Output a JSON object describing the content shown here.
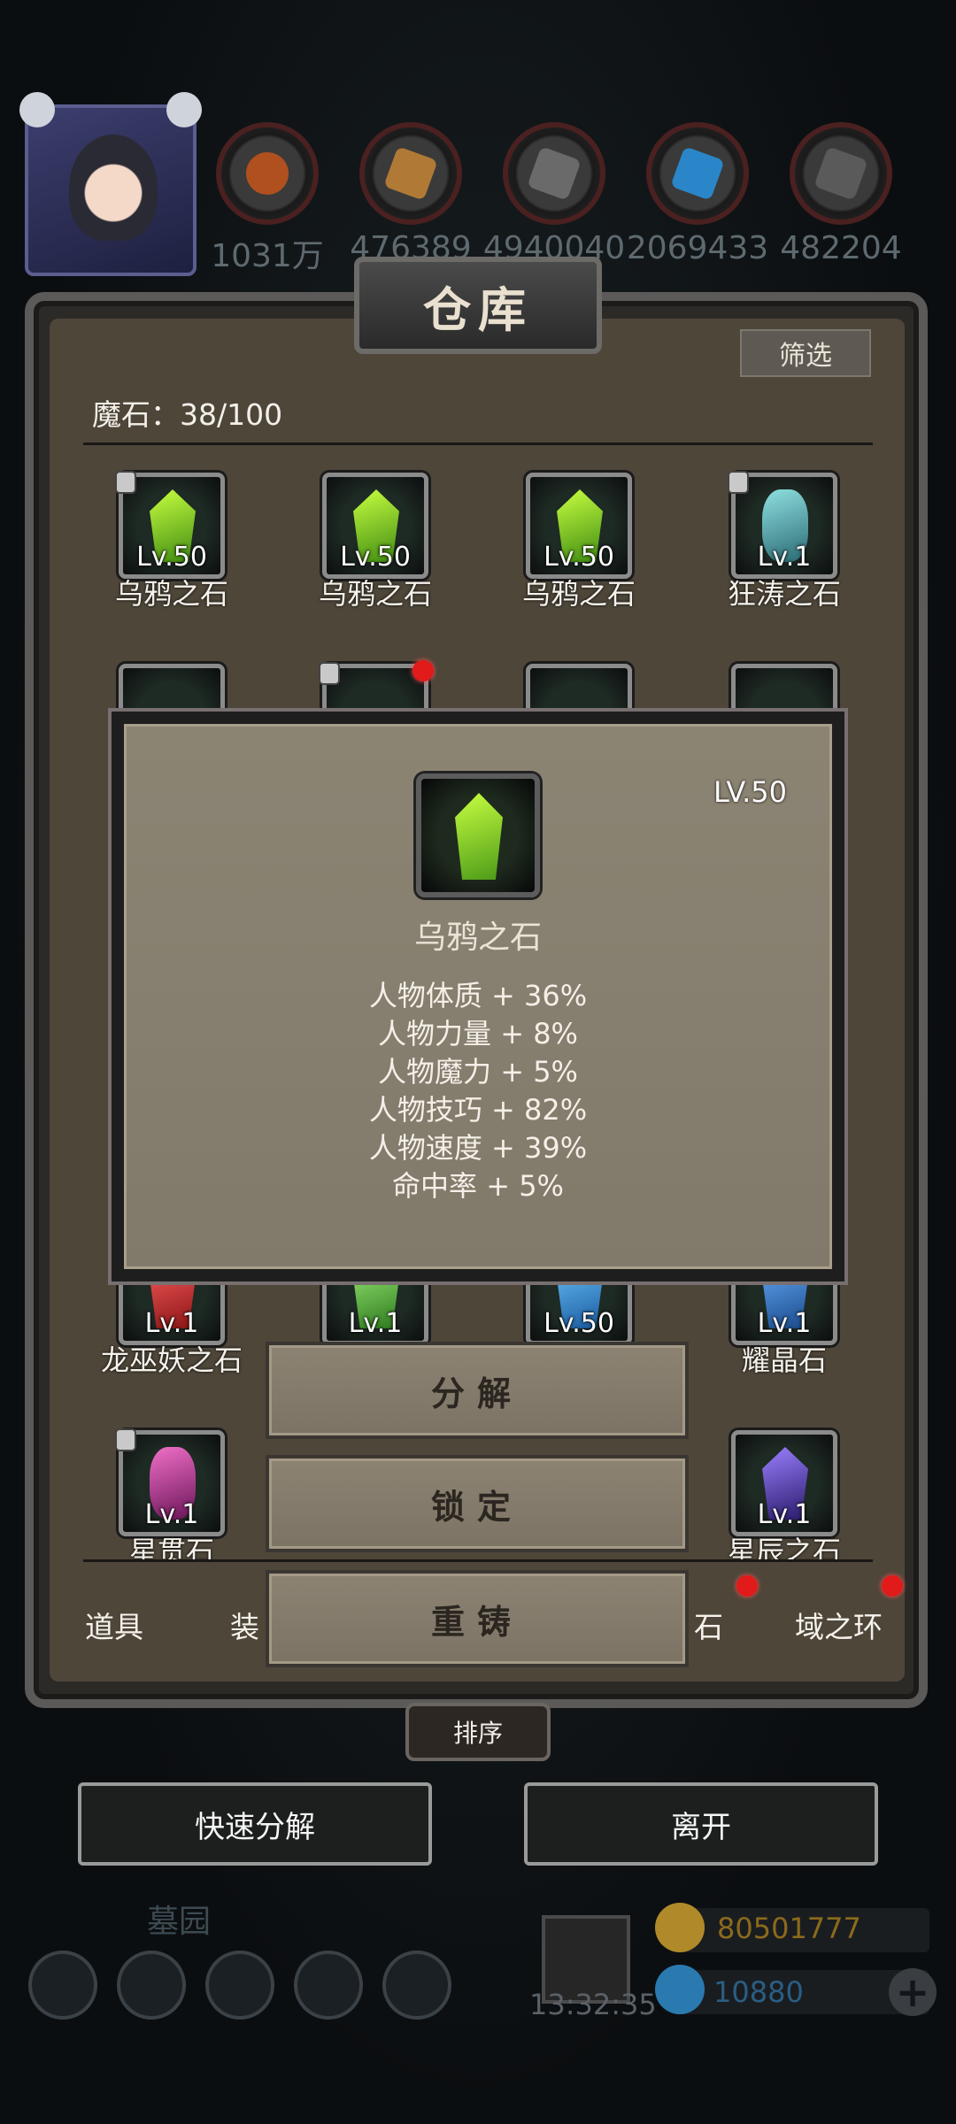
{
  "resources": [
    {
      "icon": "meat-icon",
      "value": "1031万"
    },
    {
      "icon": "wood-icon",
      "value": "476389"
    },
    {
      "icon": "iron-icon",
      "value": "4940040"
    },
    {
      "icon": "crystal-icon",
      "value": "2069433"
    },
    {
      "icon": "stone-icon",
      "value": "482204"
    }
  ],
  "warehouse": {
    "title": "仓库",
    "filter_label": "筛选",
    "count_label": "魔石：38/100"
  },
  "items_row1": [
    {
      "level": "Lv.50",
      "name": "乌鸦之石",
      "color": "#8ee02a",
      "locked": true
    },
    {
      "level": "Lv.50",
      "name": "乌鸦之石",
      "color": "#8ee02a",
      "locked": false
    },
    {
      "level": "Lv.50",
      "name": "乌鸦之石",
      "color": "#8ee02a",
      "locked": false
    },
    {
      "level": "Lv.1",
      "name": "狂涛之石",
      "color": "#4aa0a8",
      "locked": true
    }
  ],
  "items_row3": [
    {
      "level": "Lv.1",
      "name": "龙巫妖之石",
      "color": "#d02a2a"
    },
    {
      "level": "Lv.1",
      "name": "",
      "color": "#56b83a"
    },
    {
      "level": "Lv.50",
      "name": "",
      "color": "#2a8ad8"
    },
    {
      "level": "Lv.1",
      "name": "耀晶石",
      "color": "#2a74c8"
    }
  ],
  "items_row4": [
    {
      "level": "Lv.1",
      "name": "星贯石",
      "color": "#c0309a"
    },
    {
      "level": "Lv.1",
      "name": "星辰之石",
      "color": "#5c3cc8"
    }
  ],
  "tabs": [
    "道具",
    "装",
    "石",
    "域之环"
  ],
  "popup": {
    "level": "LV.50",
    "name": "乌鸦之石",
    "stats": [
      "人物体质 + 36%",
      "人物力量 + 8%",
      "人物魔力 + 5%",
      "人物技巧 + 82%",
      "人物速度 + 39%",
      "命中率 + 5%"
    ]
  },
  "actions": {
    "decompose": "分解",
    "lock": "锁定",
    "recast": "重铸"
  },
  "sort_label": "排序",
  "quick_decompose_label": "快速分解",
  "leave_label": "离开",
  "hud": {
    "graveyard_label": "墓园",
    "time": "13:32:35",
    "gold": "80501777",
    "diamonds": "10880"
  }
}
